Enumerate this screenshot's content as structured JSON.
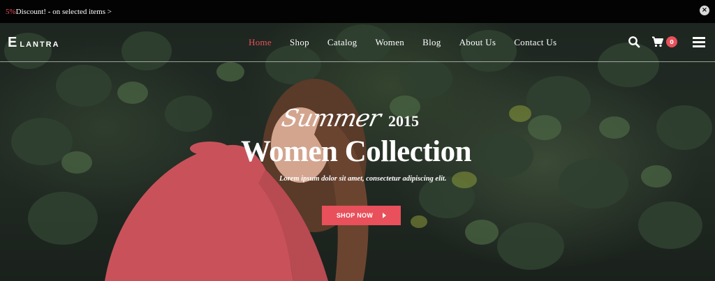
{
  "promo": {
    "percent": "5%",
    "text": " Discount! - on selected items >",
    "close_icon": "close-icon"
  },
  "header": {
    "logo_initial": "E",
    "logo_rest": "LANTRA",
    "nav": [
      {
        "label": "Home",
        "active": true
      },
      {
        "label": "Shop"
      },
      {
        "label": "Catalog"
      },
      {
        "label": "Women"
      },
      {
        "label": "Blog"
      },
      {
        "label": "About Us"
      },
      {
        "label": "Contact Us"
      }
    ],
    "cart_count": "0",
    "icons": [
      "search-icon",
      "cart-icon",
      "menu-icon"
    ]
  },
  "hero": {
    "script": "Summer",
    "year": "2015",
    "headline": "Women Collection",
    "subline": "Lorem ipsum dolor sit amet, consectetur adipiscing elit.",
    "cta": "SHOP NOW"
  },
  "colors": {
    "accent": "#e8505b",
    "promo_bg": "#030303"
  }
}
